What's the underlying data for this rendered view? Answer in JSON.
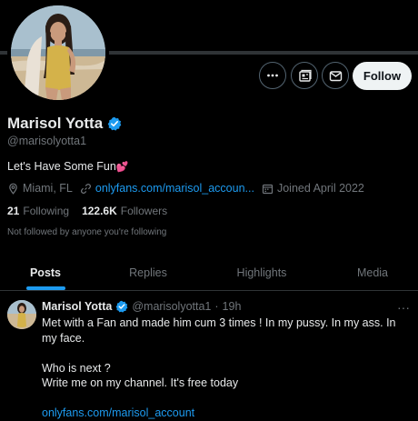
{
  "profile": {
    "display_name": "Marisol Yotta",
    "handle": "@marisolyotta1",
    "bio_text": "Let's Have Some Fun",
    "bio_emoji": "💕",
    "location": "Miami, FL",
    "website": "onlyfans.com/marisol_accoun...",
    "joined": "Joined April 2022",
    "following_count": "21",
    "following_label": "Following",
    "followers_count": "122.6K",
    "followers_label": "Followers",
    "not_followed_text": "Not followed by anyone you're following"
  },
  "actions": {
    "more_icon": "more-horizontal-icon",
    "subscribe_icon": "newsletter-icon",
    "message_icon": "mail-icon",
    "follow_label": "Follow"
  },
  "tabs": [
    {
      "label": "Posts",
      "active": true
    },
    {
      "label": "Replies",
      "active": false
    },
    {
      "label": "Highlights",
      "active": false
    },
    {
      "label": "Media",
      "active": false
    }
  ],
  "tweet": {
    "name": "Marisol Yotta",
    "handle": "@marisolyotta1",
    "separator": "·",
    "time": "19h",
    "line1": "Met with a Fan and made him cum 3 times ! In my pussy. In my ass. In my face.",
    "line2": "Who is next ?",
    "line3": "Write me on my channel. It's free today",
    "link": "onlyfans.com/marisol_account",
    "more": "···"
  },
  "colors": {
    "background": "#000000",
    "accent": "#1d9bf0",
    "text": "#e7e9ea",
    "muted": "#71767b",
    "verified": "#1d9bf0"
  }
}
